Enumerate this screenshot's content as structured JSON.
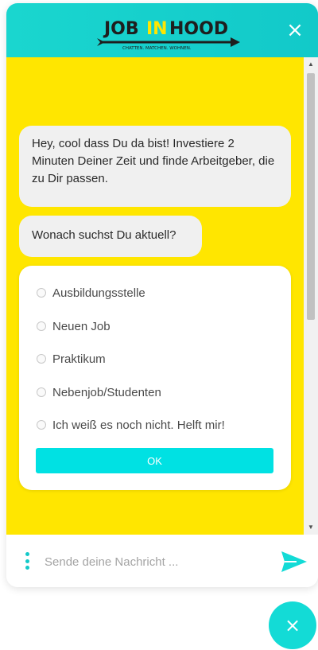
{
  "header": {
    "logo_part1": "JOB",
    "logo_part2": "IN",
    "logo_part3": "HOOD",
    "logo_tagline": "CHATTEN. MATCHEN. WOHNEN.",
    "close_glyph": "×",
    "colors": {
      "header_bg": "#1ad6cf",
      "logo_accent": "#ffe600"
    }
  },
  "chat": {
    "background": "#ffe600",
    "messages": [
      {
        "text": "Hey, cool dass Du da bist! Investiere 2 Minuten Deiner Zeit und finde Arbeitgeber, die zu Dir passen."
      },
      {
        "text": "Wonach suchst Du aktuell?"
      }
    ],
    "options": [
      {
        "label": "Ausbildungsstelle"
      },
      {
        "label": "Neuen Job"
      },
      {
        "label": "Praktikum"
      },
      {
        "label": "Nebenjob/Studenten"
      },
      {
        "label": "Ich weiß es noch nicht. Helft mir!"
      }
    ],
    "ok_label": "OK",
    "scroll_up_glyph": "▲",
    "scroll_down_glyph": "▼"
  },
  "footer": {
    "placeholder": "Sende deine Nachricht ...",
    "menu_icon": "vertical-dots-icon",
    "send_icon": "paper-plane-icon"
  },
  "launcher": {
    "close_glyph": "×",
    "color": "#13dbd6"
  }
}
